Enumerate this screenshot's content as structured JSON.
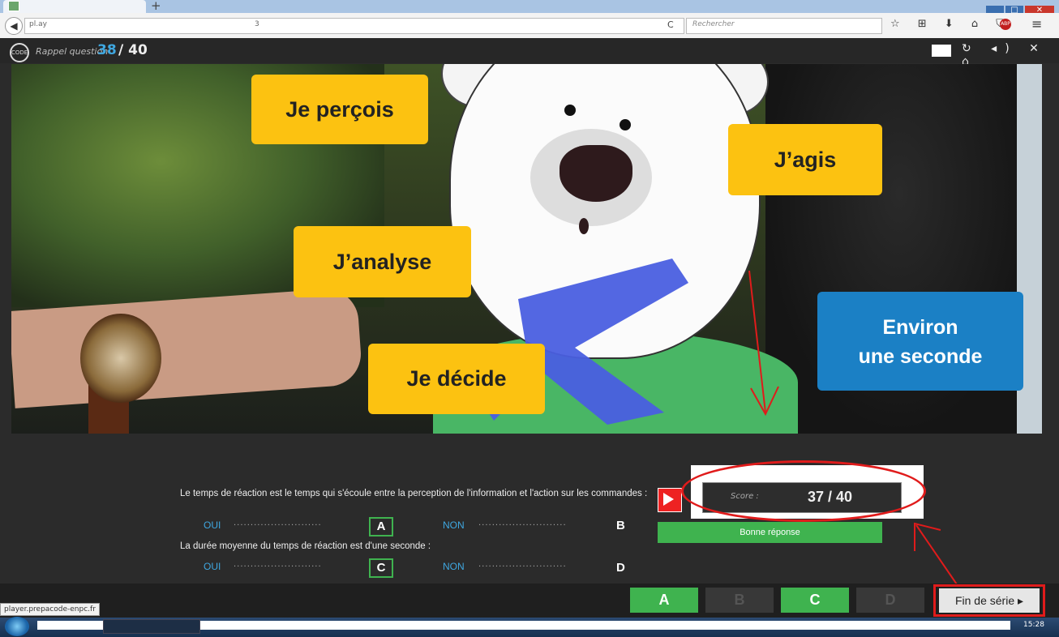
{
  "browser": {
    "tab_title": "",
    "new_tab_label": "+",
    "back_label": "◀",
    "url_text": "pl.ay",
    "url_fragment": "3",
    "reload_label": "C",
    "search_placeholder": "Rechercher",
    "nav_icons": "☆ ⊞ ⬇ ⌂ ⛉",
    "adblock_label": "ABP",
    "menu_label": "≡"
  },
  "header": {
    "logo_text": "CODE",
    "question_label": "Rappel question",
    "question_current": "38",
    "question_total": "/ 40",
    "icons": "↻ ◂) ✕ ⌂"
  },
  "scene": {
    "bubbles": {
      "percois": "Je perçois",
      "agis": "J’agis",
      "analyse": "J’analyse",
      "decide": "Je décide",
      "seconde_line1": "Environ",
      "seconde_line2": "une seconde"
    }
  },
  "question": {
    "q1": "Le temps de réaction est le temps qui s'écoule entre la perception de l'information et l'action sur les commandes :",
    "q2": "La durée moyenne du temps de réaction est d'une seconde :",
    "yes": "OUI",
    "no": "NON",
    "letters": {
      "a": "A",
      "b": "B",
      "c": "C",
      "d": "D"
    },
    "dots": "··························"
  },
  "score": {
    "label": "Score :",
    "value": "37 / 40",
    "result": "Bonne réponse"
  },
  "answers": [
    {
      "label": "A",
      "selected": true
    },
    {
      "label": "B",
      "selected": false
    },
    {
      "label": "C",
      "selected": true
    },
    {
      "label": "D",
      "selected": false
    }
  ],
  "end_button": "Fin de série ▸",
  "status_url": "player.prepacode-enpc.fr",
  "taskbar": {
    "clock": "15:28"
  },
  "colors": {
    "accent_blue": "#3fa7e0",
    "correct_green": "#3fb34f",
    "bubble_yellow": "#fcc211",
    "bubble_blue": "#1b80c5",
    "annotation_red": "#e01b1b"
  }
}
